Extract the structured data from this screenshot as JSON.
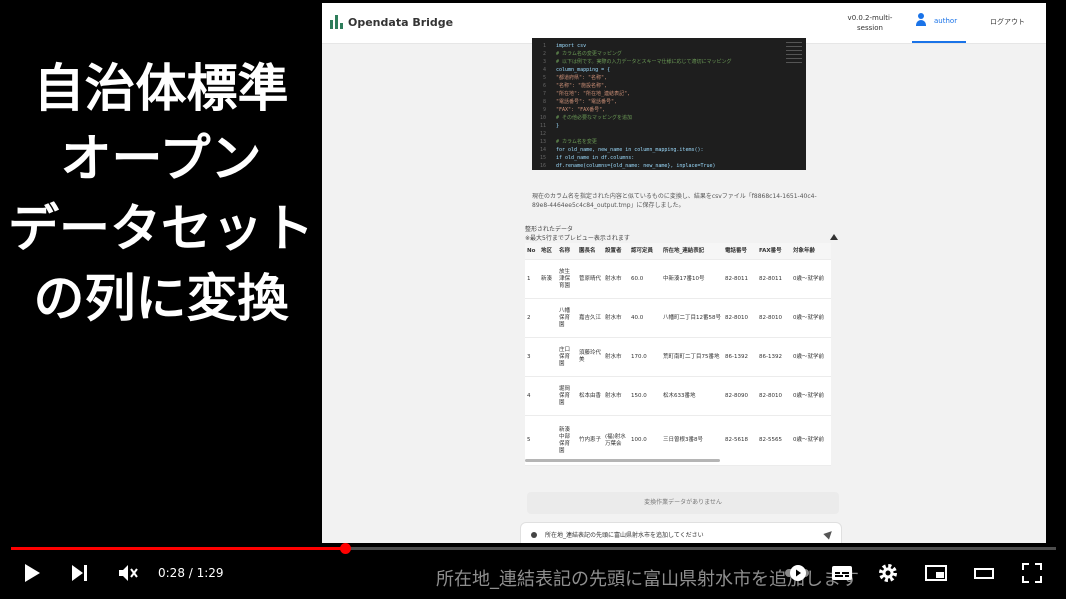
{
  "overlay_caption": [
    "自治体標準",
    "オープン",
    "データセット",
    "の列に変換"
  ],
  "app": {
    "name": "Opendata Bridge",
    "version": "v0.0.2-multi-session",
    "user": "author",
    "logout": "ログアウト"
  },
  "code_lines": [
    "import csv",
    "# カラム名の変更マッピング",
    "# 以下は例です。実際の入力データとスキーマ仕様に応じて適切にマッピング",
    "column_mapping = {",
    "    \"都道府県\": \"名称\",",
    "    \"名称\": \"施設名称\",",
    "    \"所在地\": \"所在地_連結表記\",",
    "    \"電話番号\": \"電話番号\",",
    "    \"FAX\": \"FAX番号\",",
    "    # その他必要なマッピングを追加",
    "}",
    "",
    "# カラム名を変更",
    "for old_name, new_name in column_mapping.items():",
    "    if old_name in df.columns:",
    "        df.rename(columns={old_name: new_name}, inplace=True)"
  ],
  "description": "現在のカラム名を指定された内容と似ているものに変換し、結果をcsvファイル「f8868c14-1651-40c4-89e8-4464ee5c4c84_output.tmp」に保存しました。",
  "table_title": "整形されたデータ",
  "table_note": "※最大5行までプレビュー表示されます",
  "table": {
    "headers": [
      "No",
      "地区",
      "名称",
      "園長名",
      "設置者",
      "認可定員",
      "所在地_連結表記",
      "電話番号",
      "FAX番号",
      "対象年齢"
    ],
    "rows": [
      [
        "1",
        "新湊",
        "放生津保育園",
        "菅原晴代",
        "射水市",
        "60.0",
        "中新湊17番10号",
        "82-8011",
        "82-8011",
        "0歳～就学前"
      ],
      [
        "2",
        "",
        "八幡保育園",
        "嘉吉久江",
        "射水市",
        "40.0",
        "八幡町二丁目12番58号",
        "82-8010",
        "82-8010",
        "0歳～就学前"
      ],
      [
        "3",
        "",
        "庄口保育園",
        "須藤玲代美",
        "射水市",
        "170.0",
        "荒町南町二丁目75番地",
        "86-1392",
        "86-1392",
        "0歳～就学前"
      ],
      [
        "4",
        "",
        "堀岡保育園",
        "松本由香",
        "射水市",
        "150.0",
        "松木633番地",
        "82-8090",
        "82-8010",
        "0歳～就学前"
      ],
      [
        "5",
        "",
        "新湊中部保育園",
        "竹内恵子",
        "(福)射水万葉会",
        "100.0",
        "三日曽根3番8号",
        "82-5618",
        "82-5565",
        "0歳～就学前"
      ]
    ]
  },
  "empty_message": "変換作業データがありません",
  "chat_input": "所在地_連結表記の先頭に富山県射水市を追加してください",
  "player": {
    "time": "0:28 / 1:29",
    "progress_fraction": 0.32,
    "subtitle": "所在地_連結表記の先頭に富山県射水市を追加します"
  },
  "icons": {
    "play": "play-icon",
    "next": "skip-next-icon",
    "mute": "volume-muted-icon",
    "autoplay": "autoplay-toggle-icon",
    "captions": "subtitles-icon",
    "settings": "gear-icon",
    "miniplayer": "miniplayer-icon",
    "theater": "theater-mode-icon",
    "fullscreen": "fullscreen-icon"
  }
}
